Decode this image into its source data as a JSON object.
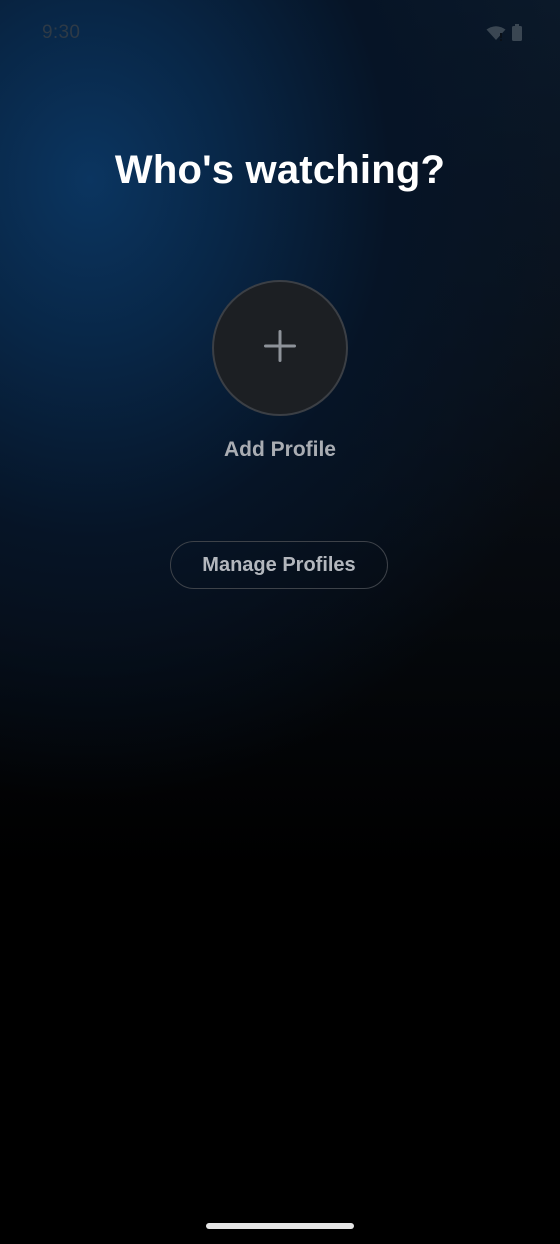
{
  "status_bar": {
    "time": "9:30",
    "wifi_icon": "wifi-icon",
    "battery_icon": "battery-icon"
  },
  "header": {
    "title": "Who's watching?"
  },
  "profiles": {
    "add_profile_icon": "plus-icon",
    "add_profile_label": "Add Profile"
  },
  "actions": {
    "manage_profiles_label": "Manage Profiles"
  },
  "colors": {
    "accent_blue": "#0b3560",
    "background": "#000000",
    "title_text": "#ffffff",
    "muted_text": "#a9adb3"
  }
}
